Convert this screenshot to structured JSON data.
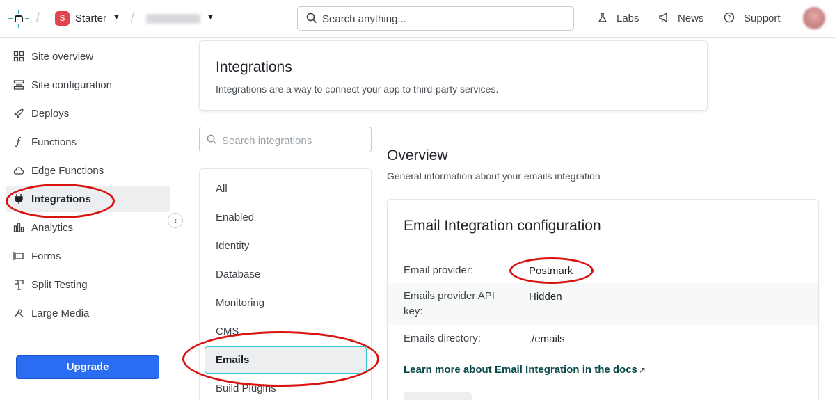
{
  "topbar": {
    "team_initial": "S",
    "team_name": "Starter",
    "search_placeholder": "Search anything...",
    "labs": "Labs",
    "news": "News",
    "support": "Support"
  },
  "sidebar": {
    "items": [
      {
        "label": "Site overview",
        "icon": "grid-icon"
      },
      {
        "label": "Site configuration",
        "icon": "config-icon"
      },
      {
        "label": "Deploys",
        "icon": "rocket-icon"
      },
      {
        "label": "Functions",
        "icon": "function-icon"
      },
      {
        "label": "Edge Functions",
        "icon": "cloud-icon"
      },
      {
        "label": "Integrations",
        "icon": "plug-icon",
        "active": true
      },
      {
        "label": "Analytics",
        "icon": "bar-chart-icon"
      },
      {
        "label": "Forms",
        "icon": "form-icon"
      },
      {
        "label": "Split Testing",
        "icon": "split-icon"
      },
      {
        "label": "Large Media",
        "icon": "media-icon"
      }
    ],
    "upgrade": "Upgrade"
  },
  "header": {
    "title": "Integrations",
    "subtitle": "Integrations are a way to connect your app to third-party services."
  },
  "integrations": {
    "search_placeholder": "Search integrations",
    "categories": [
      "All",
      "Enabled",
      "Identity",
      "Database",
      "Monitoring",
      "CMS",
      "Emails",
      "Build Plugins"
    ],
    "active_category": "Emails"
  },
  "overview": {
    "title": "Overview",
    "subtitle": "General information about your emails integration"
  },
  "config": {
    "title": "Email Integration configuration",
    "fields": [
      {
        "label": "Email provider:",
        "value": "Postmark"
      },
      {
        "label": "Emails provider API key:",
        "value": "Hidden"
      },
      {
        "label": "Emails directory:",
        "value": "./emails"
      }
    ],
    "docs_link": "Learn more about Email Integration in the docs"
  },
  "colors": {
    "accent": "#2a6cf2",
    "teal": "#30c8c9",
    "annotation": "#d9130f",
    "badge": "#e0454e"
  }
}
